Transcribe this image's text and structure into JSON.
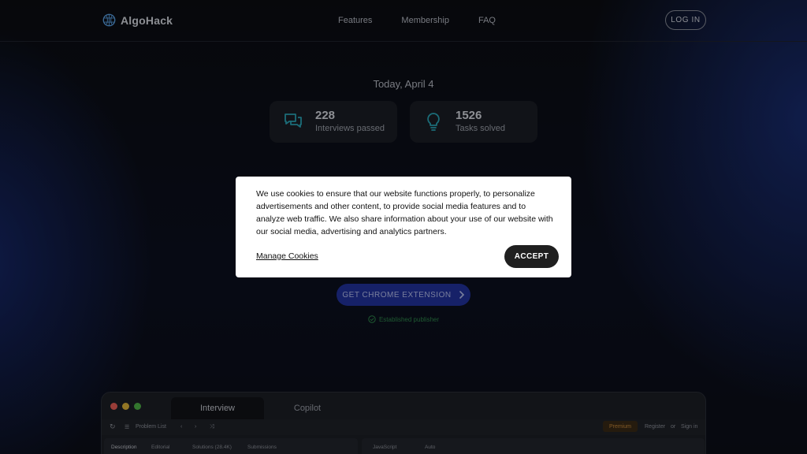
{
  "header": {
    "logo_text": "AlgoHack",
    "nav": [
      "Features",
      "Membership",
      "FAQ"
    ],
    "login_label": "LOG IN"
  },
  "hero": {
    "date": "Today, April 4",
    "stats": [
      {
        "value": "228",
        "label": "Interviews passed",
        "icon": "chat-bubbles-icon"
      },
      {
        "value": "1526",
        "label": "Tasks solved",
        "icon": "lightbulb-icon"
      }
    ],
    "cta_label": "GET CHROME EXTENSION",
    "publisher_label": "Established publisher"
  },
  "app_preview": {
    "tabs": [
      "Interview",
      "Copilot"
    ],
    "toolbar": {
      "problem_list": "Problem List",
      "premium": "Premium",
      "register": "Register",
      "or": "or",
      "sign_in": "Sign in"
    },
    "left_tabs": [
      "Description",
      "Editorial",
      "Solutions (28.4K)",
      "Submissions"
    ],
    "right_tabs": [
      "JavaScript",
      "Auto"
    ]
  },
  "cookie_banner": {
    "text": "We use cookies to ensure that our website functions properly, to personalize advertisements and other content, to provide social media features and to analyze web traffic. We also share information about your use of our website with our social media, advertising and analytics partners.",
    "manage_label": "Manage Cookies",
    "accept_label": "ACCEPT"
  },
  "colors": {
    "accent_blue": "#2334a0",
    "accent_teal": "#2aa6b8",
    "success_green": "#2f8a4c",
    "mac_red": "#ec5f57",
    "mac_yellow": "#e0b53a",
    "mac_green": "#4fb548"
  }
}
